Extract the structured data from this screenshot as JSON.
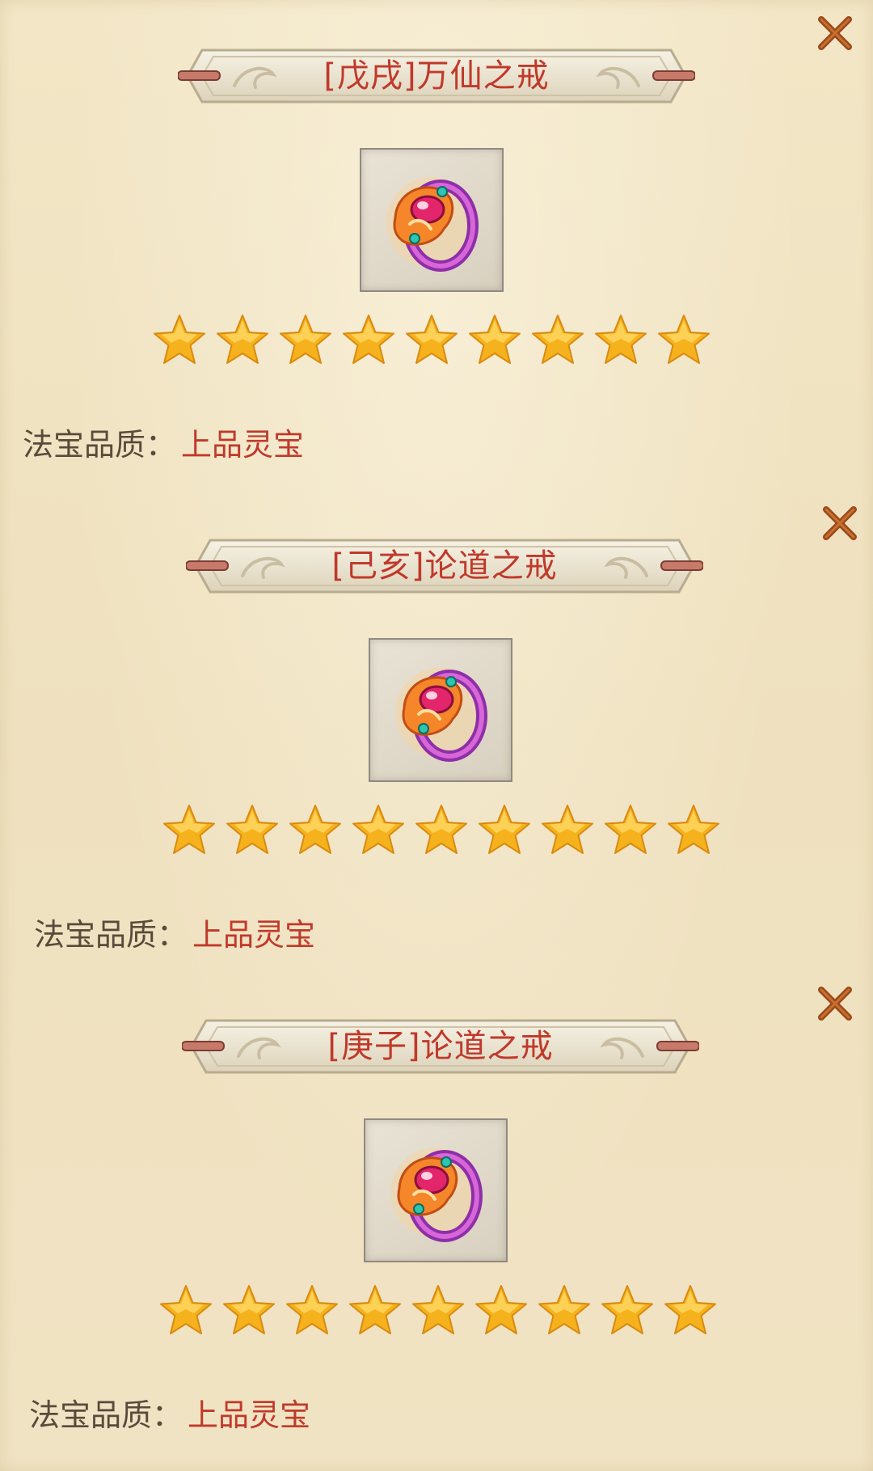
{
  "colors": {
    "background": "#f0e3c2",
    "title_text": "#c0392b",
    "quality_value": "#c0392b",
    "quality_label": "#5a4a3c",
    "close_icon": "#9a4a1c",
    "star_fill": "#f6b21c"
  },
  "cards": [
    {
      "title": "[戊戌]万仙之戒",
      "icon": "ring-icon",
      "stars": 9,
      "quality_label": "法宝品质：",
      "quality_value": "上品灵宝"
    },
    {
      "title": "[己亥]论道之戒",
      "icon": "ring-icon",
      "stars": 9,
      "quality_label": "法宝品质：",
      "quality_value": "上品灵宝"
    },
    {
      "title": "[庚子]论道之戒",
      "icon": "ring-icon",
      "stars": 9,
      "quality_label": "法宝品质：",
      "quality_value": "上品灵宝"
    }
  ]
}
